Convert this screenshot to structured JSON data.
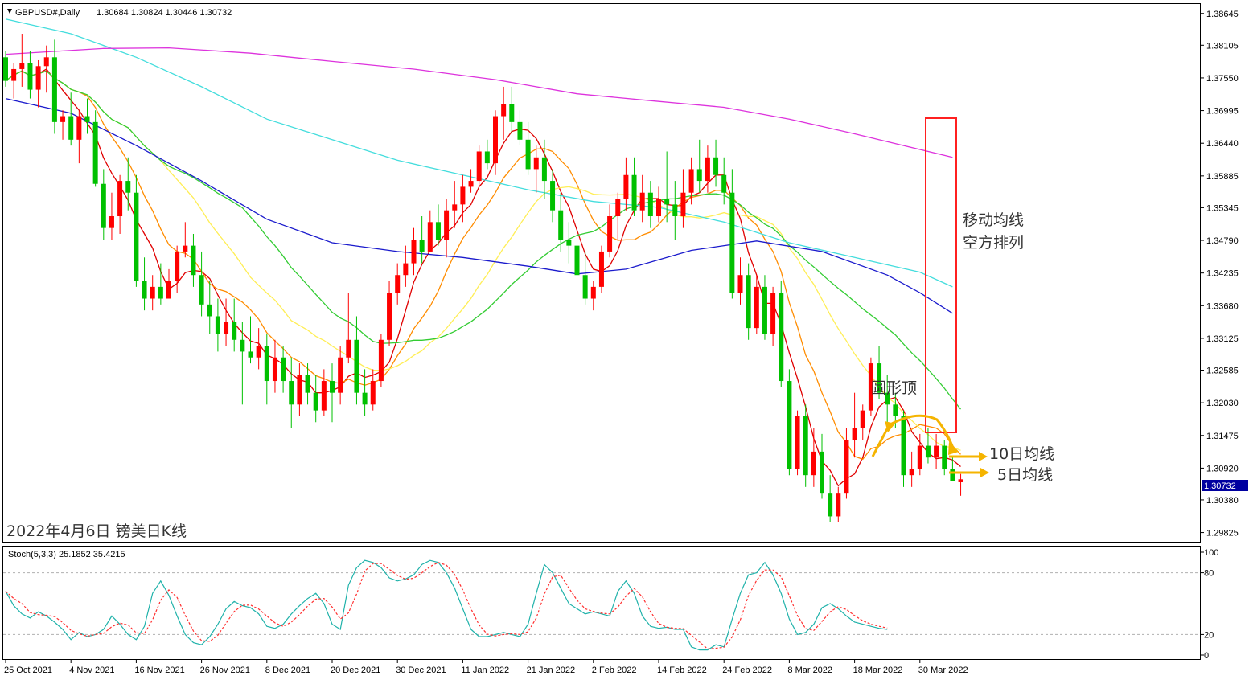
{
  "header": {
    "symbol": "GBPUSD#,Daily",
    "ohlc": "1.30684 1.30824 1.30446 1.30732"
  },
  "stoch_header": "Stoch(5,3,3) 25.1852 35.4215",
  "caption": "2022年4月6日 镑美日K线",
  "annotations": {
    "ma_bearish_line1": "移动均线",
    "ma_bearish_line2": "空方排列",
    "rounding_top": "圆形顶",
    "ma10": "10日均线",
    "ma5": "5日均线"
  },
  "colors": {
    "bull": "#ff0000",
    "bear": "#00c000",
    "ma5": "#e00000",
    "ma10": "#ff8c00",
    "ma20": "#ffee55",
    "ma30": "#33cc33",
    "ma60": "#1a1acc",
    "ma120": "#44dddd",
    "ma250": "#dd33dd",
    "stoch_main": "#20b2aa",
    "stoch_signal": "#ff3030",
    "annotation_box": "#ff2020",
    "annotation_arrow": "#f5b400",
    "price_box": "#0000a0"
  },
  "current_price": "1.30732",
  "chart_data": {
    "type": "candlestick",
    "symbol": "GBPUSD#",
    "timeframe": "Daily",
    "y_ticks": [
      "1.38645",
      "1.38105",
      "1.37550",
      "1.36995",
      "1.36440",
      "1.35885",
      "1.35345",
      "1.34790",
      "1.34235",
      "1.33680",
      "1.33125",
      "1.32585",
      "1.32030",
      "1.31475",
      "1.30920",
      "1.30380",
      "1.29825"
    ],
    "ylim": [
      1.2971,
      1.3871
    ],
    "x_ticks": [
      {
        "label": "25 Oct 2021",
        "idx": 0
      },
      {
        "label": "4 Nov 2021",
        "idx": 8
      },
      {
        "label": "16 Nov 2021",
        "idx": 16
      },
      {
        "label": "26 Nov 2021",
        "idx": 24
      },
      {
        "label": "8 Dec 2021",
        "idx": 32
      },
      {
        "label": "20 Dec 2021",
        "idx": 40
      },
      {
        "label": "30 Dec 2021",
        "idx": 48
      },
      {
        "label": "11 Jan 2022",
        "idx": 56
      },
      {
        "label": "21 Jan 2022",
        "idx": 64
      },
      {
        "label": "2 Feb 2022",
        "idx": 72
      },
      {
        "label": "14 Feb 2022",
        "idx": 80
      },
      {
        "label": "24 Feb 2022",
        "idx": 88
      },
      {
        "label": "8 Mar 2022",
        "idx": 96
      },
      {
        "label": "18 Mar 2022",
        "idx": 104
      },
      {
        "label": "30 Mar 2022",
        "idx": 112
      }
    ],
    "stoch_ticks": [
      "100",
      "80",
      "20",
      "0"
    ],
    "stoch_levels": [
      80,
      20
    ],
    "moving_averages": [
      {
        "name": "MA5",
        "color": "#e00000",
        "period": 5
      },
      {
        "name": "MA10",
        "color": "#ff8c00",
        "period": 10
      },
      {
        "name": "MA20",
        "color": "#ffee55",
        "period": 20
      },
      {
        "name": "MA30",
        "color": "#33cc33",
        "period": 30
      }
    ],
    "long_mas": [
      {
        "name": "MA60",
        "color": "#1a1acc",
        "points": [
          [
            0,
            1.372
          ],
          [
            8,
            1.3695
          ],
          [
            16,
            1.364
          ],
          [
            24,
            1.358
          ],
          [
            32,
            1.3515
          ],
          [
            40,
            1.3475
          ],
          [
            48,
            1.346
          ],
          [
            56,
            1.345
          ],
          [
            64,
            1.3435
          ],
          [
            70,
            1.3422
          ],
          [
            76,
            1.343
          ],
          [
            84,
            1.3462
          ],
          [
            92,
            1.3478
          ],
          [
            100,
            1.346
          ],
          [
            108,
            1.342
          ],
          [
            112,
            1.339
          ],
          [
            116,
            1.3355
          ]
        ]
      },
      {
        "name": "MA120",
        "color": "#44dddd",
        "points": [
          [
            0,
            1.3855
          ],
          [
            8,
            1.383
          ],
          [
            16,
            1.379
          ],
          [
            24,
            1.374
          ],
          [
            32,
            1.3685
          ],
          [
            40,
            1.365
          ],
          [
            48,
            1.3615
          ],
          [
            56,
            1.359
          ],
          [
            64,
            1.3565
          ],
          [
            72,
            1.3545
          ],
          [
            80,
            1.3535
          ],
          [
            88,
            1.351
          ],
          [
            96,
            1.3475
          ],
          [
            104,
            1.345
          ],
          [
            112,
            1.3425
          ],
          [
            116,
            1.34
          ]
        ]
      },
      {
        "name": "MA250",
        "color": "#dd33dd",
        "points": [
          [
            0,
            1.3795
          ],
          [
            12,
            1.3805
          ],
          [
            20,
            1.3806
          ],
          [
            30,
            1.3797
          ],
          [
            40,
            1.3783
          ],
          [
            50,
            1.377
          ],
          [
            60,
            1.3752
          ],
          [
            70,
            1.3728
          ],
          [
            80,
            1.3715
          ],
          [
            88,
            1.3705
          ],
          [
            96,
            1.3685
          ],
          [
            104,
            1.366
          ],
          [
            110,
            1.364
          ],
          [
            116,
            1.362
          ]
        ]
      }
    ],
    "candles": [
      [
        1.379,
        1.38,
        1.374,
        1.375
      ],
      [
        1.375,
        1.378,
        1.372,
        1.377
      ],
      [
        1.377,
        1.383,
        1.374,
        1.378
      ],
      [
        1.378,
        1.38,
        1.372,
        1.3735
      ],
      [
        1.3735,
        1.3785,
        1.3705,
        1.3775
      ],
      [
        1.3775,
        1.381,
        1.373,
        1.379
      ],
      [
        1.379,
        1.382,
        1.366,
        1.368
      ],
      [
        1.368,
        1.37,
        1.365,
        1.369
      ],
      [
        1.369,
        1.373,
        1.364,
        1.365
      ],
      [
        1.365,
        1.37,
        1.361,
        1.369
      ],
      [
        1.369,
        1.372,
        1.366,
        1.368
      ],
      [
        1.368,
        1.37,
        1.357,
        1.3575
      ],
      [
        1.3575,
        1.36,
        1.348,
        1.35
      ],
      [
        1.35,
        1.356,
        1.348,
        1.352
      ],
      [
        1.352,
        1.359,
        1.349,
        1.358
      ],
      [
        1.358,
        1.362,
        1.353,
        1.356
      ],
      [
        1.356,
        1.359,
        1.34,
        1.341
      ],
      [
        1.341,
        1.345,
        1.336,
        1.338
      ],
      [
        1.338,
        1.342,
        1.336,
        1.34
      ],
      [
        1.34,
        1.344,
        1.337,
        1.338
      ],
      [
        1.338,
        1.343,
        1.338,
        1.341
      ],
      [
        1.341,
        1.347,
        1.339,
        1.346
      ],
      [
        1.346,
        1.351,
        1.345,
        1.347
      ],
      [
        1.347,
        1.349,
        1.34,
        1.342
      ],
      [
        1.342,
        1.346,
        1.335,
        1.337
      ],
      [
        1.337,
        1.341,
        1.332,
        1.335
      ],
      [
        1.335,
        1.338,
        1.329,
        1.332
      ],
      [
        1.332,
        1.338,
        1.33,
        1.334
      ],
      [
        1.334,
        1.338,
        1.329,
        1.331
      ],
      [
        1.331,
        1.334,
        1.32,
        1.329
      ],
      [
        1.329,
        1.335,
        1.327,
        1.328
      ],
      [
        1.328,
        1.333,
        1.326,
        1.33
      ],
      [
        1.33,
        1.332,
        1.32,
        1.324
      ],
      [
        1.324,
        1.331,
        1.322,
        1.328
      ],
      [
        1.328,
        1.33,
        1.322,
        1.324
      ],
      [
        1.324,
        1.328,
        1.316,
        1.32
      ],
      [
        1.32,
        1.327,
        1.318,
        1.325
      ],
      [
        1.325,
        1.327,
        1.32,
        1.322
      ],
      [
        1.322,
        1.325,
        1.317,
        1.319
      ],
      [
        1.319,
        1.326,
        1.318,
        1.324
      ],
      [
        1.324,
        1.327,
        1.317,
        1.322
      ],
      [
        1.322,
        1.33,
        1.32,
        1.328
      ],
      [
        1.328,
        1.339,
        1.327,
        1.331
      ],
      [
        1.331,
        1.335,
        1.32,
        1.322
      ],
      [
        1.322,
        1.326,
        1.318,
        1.32
      ],
      [
        1.32,
        1.326,
        1.319,
        1.324
      ],
      [
        1.324,
        1.332,
        1.323,
        1.331
      ],
      [
        1.331,
        1.341,
        1.33,
        1.339
      ],
      [
        1.339,
        1.344,
        1.337,
        1.342
      ],
      [
        1.342,
        1.347,
        1.34,
        1.344
      ],
      [
        1.344,
        1.35,
        1.342,
        1.348
      ],
      [
        1.348,
        1.352,
        1.344,
        1.346
      ],
      [
        1.346,
        1.353,
        1.346,
        1.351
      ],
      [
        1.351,
        1.354,
        1.347,
        1.348
      ],
      [
        1.348,
        1.355,
        1.345,
        1.353
      ],
      [
        1.353,
        1.358,
        1.35,
        1.354
      ],
      [
        1.354,
        1.359,
        1.351,
        1.357
      ],
      [
        1.357,
        1.36,
        1.356,
        1.358
      ],
      [
        1.358,
        1.364,
        1.357,
        1.363
      ],
      [
        1.363,
        1.365,
        1.36,
        1.361
      ],
      [
        1.361,
        1.37,
        1.359,
        1.369
      ],
      [
        1.369,
        1.374,
        1.365,
        1.371
      ],
      [
        1.371,
        1.374,
        1.366,
        1.368
      ],
      [
        1.368,
        1.37,
        1.364,
        1.365
      ],
      [
        1.365,
        1.368,
        1.359,
        1.36
      ],
      [
        1.36,
        1.364,
        1.356,
        1.362
      ],
      [
        1.362,
        1.365,
        1.355,
        1.358
      ],
      [
        1.358,
        1.36,
        1.351,
        1.353
      ],
      [
        1.353,
        1.356,
        1.346,
        1.348
      ],
      [
        1.348,
        1.351,
        1.344,
        1.347
      ],
      [
        1.347,
        1.35,
        1.341,
        1.342
      ],
      [
        1.342,
        1.346,
        1.337,
        1.338
      ],
      [
        1.338,
        1.341,
        1.336,
        1.34
      ],
      [
        1.34,
        1.347,
        1.339,
        1.346
      ],
      [
        1.346,
        1.354,
        1.345,
        1.352
      ],
      [
        1.352,
        1.356,
        1.348,
        1.355
      ],
      [
        1.355,
        1.362,
        1.353,
        1.359
      ],
      [
        1.359,
        1.362,
        1.352,
        1.353
      ],
      [
        1.353,
        1.359,
        1.351,
        1.356
      ],
      [
        1.356,
        1.358,
        1.35,
        1.352
      ],
      [
        1.352,
        1.357,
        1.351,
        1.355
      ],
      [
        1.355,
        1.363,
        1.351,
        1.354
      ],
      [
        1.354,
        1.358,
        1.348,
        1.352
      ],
      [
        1.352,
        1.36,
        1.35,
        1.356
      ],
      [
        1.356,
        1.362,
        1.354,
        1.36
      ],
      [
        1.36,
        1.365,
        1.356,
        1.358
      ],
      [
        1.358,
        1.364,
        1.356,
        1.362
      ],
      [
        1.362,
        1.365,
        1.357,
        1.359
      ],
      [
        1.359,
        1.362,
        1.354,
        1.356
      ],
      [
        1.356,
        1.36,
        1.338,
        1.339
      ],
      [
        1.339,
        1.345,
        1.337,
        1.342
      ],
      [
        1.342,
        1.344,
        1.331,
        1.333
      ],
      [
        1.333,
        1.342,
        1.332,
        1.34
      ],
      [
        1.34,
        1.342,
        1.331,
        1.332
      ],
      [
        1.332,
        1.34,
        1.33,
        1.339
      ],
      [
        1.339,
        1.341,
        1.323,
        1.324
      ],
      [
        1.324,
        1.326,
        1.308,
        1.309
      ],
      [
        1.309,
        1.319,
        1.308,
        1.318
      ],
      [
        1.318,
        1.32,
        1.306,
        1.308
      ],
      [
        1.308,
        1.316,
        1.306,
        1.312
      ],
      [
        1.312,
        1.315,
        1.304,
        1.305
      ],
      [
        1.305,
        1.308,
        1.3,
        1.301
      ],
      [
        1.301,
        1.306,
        1.3,
        1.305
      ],
      [
        1.305,
        1.316,
        1.304,
        1.314
      ],
      [
        1.314,
        1.322,
        1.311,
        1.316
      ],
      [
        1.316,
        1.32,
        1.314,
        1.319
      ],
      [
        1.319,
        1.328,
        1.318,
        1.327
      ],
      [
        1.327,
        1.33,
        1.321,
        1.322
      ],
      [
        1.322,
        1.325,
        1.316,
        1.32
      ],
      [
        1.32,
        1.322,
        1.316,
        1.318
      ],
      [
        1.318,
        1.319,
        1.306,
        1.308
      ],
      [
        1.308,
        1.312,
        1.306,
        1.309
      ],
      [
        1.309,
        1.315,
        1.308,
        1.313
      ],
      [
        1.313,
        1.316,
        1.31,
        1.311
      ],
      [
        1.311,
        1.315,
        1.309,
        1.313
      ],
      [
        1.313,
        1.314,
        1.308,
        1.309
      ],
      [
        1.309,
        1.311,
        1.307,
        1.307
      ],
      [
        1.3068,
        1.3082,
        1.3045,
        1.3073
      ]
    ],
    "stoch_main": [
      62,
      48,
      40,
      36,
      42,
      38,
      32,
      25,
      15,
      22,
      18,
      20,
      25,
      38,
      30,
      20,
      15,
      28,
      60,
      72,
      58,
      38,
      20,
      12,
      10,
      18,
      30,
      45,
      52,
      48,
      46,
      40,
      28,
      26,
      30,
      40,
      48,
      55,
      60,
      50,
      30,
      25,
      68,
      85,
      92,
      90,
      85,
      75,
      72,
      74,
      78,
      88,
      92,
      90,
      80,
      65,
      45,
      25,
      18,
      18,
      20,
      22,
      20,
      18,
      30,
      60,
      88,
      80,
      65,
      50,
      45,
      40,
      42,
      40,
      38,
      62,
      72,
      60,
      38,
      28,
      26,
      27,
      25,
      25,
      8,
      5,
      5,
      10,
      8,
      35,
      60,
      78,
      80,
      90,
      78,
      60,
      35,
      20,
      22,
      30,
      46,
      50,
      45,
      38,
      32,
      30,
      28,
      26,
      25
    ]
  }
}
